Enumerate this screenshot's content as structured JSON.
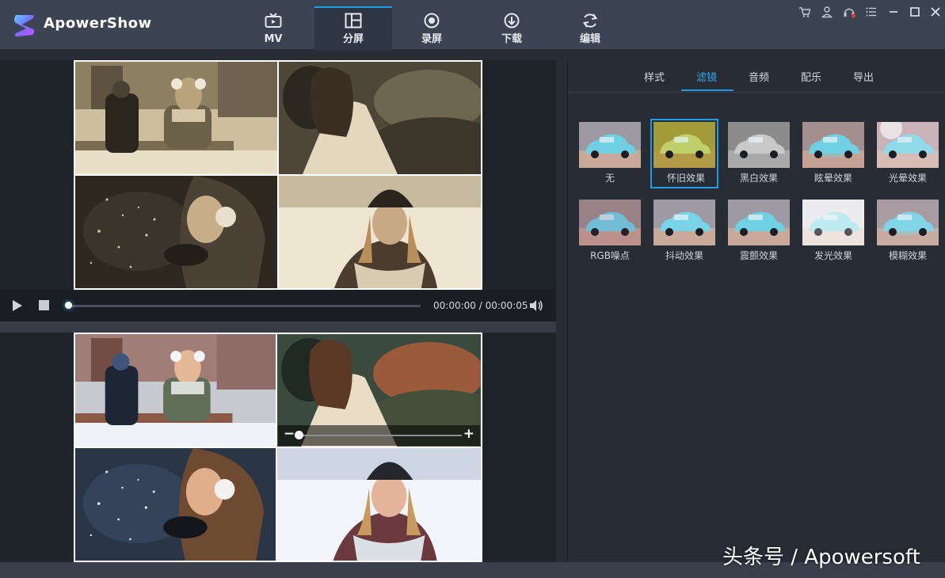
{
  "app": {
    "name": "ApowerShow"
  },
  "nav": {
    "tabs": [
      {
        "label": "MV",
        "icon": "tv-icon"
      },
      {
        "label": "分屏",
        "icon": "split-screen-icon",
        "active": true
      },
      {
        "label": "录屏",
        "icon": "record-icon"
      },
      {
        "label": "下载",
        "icon": "download-icon"
      },
      {
        "label": "编辑",
        "icon": "refresh-edit-icon"
      }
    ]
  },
  "window_controls": [
    "cart-icon",
    "user-icon",
    "support-icon",
    "menu-icon",
    "minimize-icon",
    "maximize-icon",
    "close-icon"
  ],
  "player": {
    "time": "00:00:00 / 00:00:05",
    "progress": 0
  },
  "zoom": {
    "level": 0
  },
  "right_panel": {
    "tabs": [
      "样式",
      "滤镜",
      "音频",
      "配乐",
      "导出"
    ],
    "active_tab": "滤镜",
    "filters": [
      {
        "label": "无"
      },
      {
        "label": "怀旧效果",
        "selected": true
      },
      {
        "label": "黑白效果"
      },
      {
        "label": "眩晕效果"
      },
      {
        "label": "光晕效果"
      },
      {
        "label": "RGB噪点"
      },
      {
        "label": "抖动效果"
      },
      {
        "label": "震颤效果"
      },
      {
        "label": "发光效果"
      },
      {
        "label": "模糊效果"
      }
    ]
  },
  "watermark": "头条号 / Apowersoft",
  "colors": {
    "accent": "#1e9bea",
    "topbar": "#3c4453",
    "panel": "#272c35"
  }
}
